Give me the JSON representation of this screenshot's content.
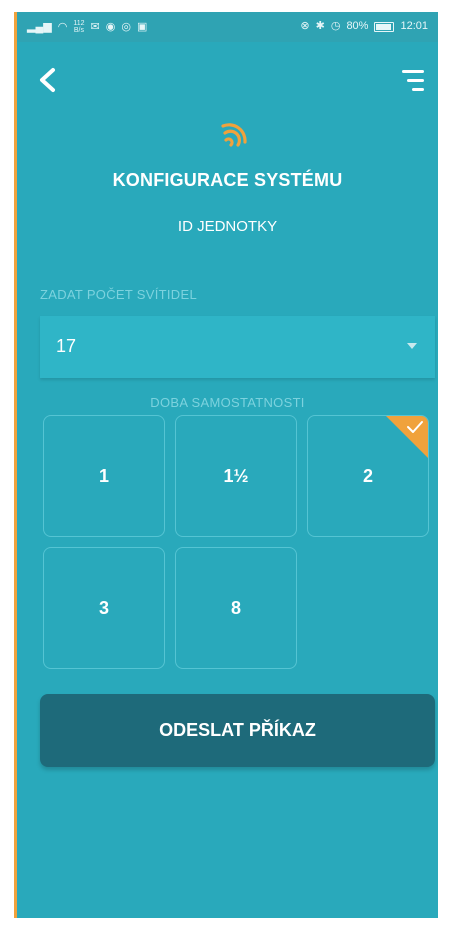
{
  "status_bar": {
    "network_speed_value": "112",
    "network_speed_unit": "B/s",
    "battery": "80%",
    "time": "12:01"
  },
  "header": {
    "back_icon": "back-chevron-icon",
    "menu_icon": "filter-menu-icon"
  },
  "logo": {
    "icon": "wireless-signal-icon",
    "accent_color": "#f0a23c"
  },
  "title": "KONFIGURACE SYSTÉMU",
  "subtitle": "ID JEDNOTKY",
  "lamp_count": {
    "label": "ZADAT POČET SVÍTIDEL",
    "value": "17"
  },
  "autonomy": {
    "label": "DOBA SAMOSTATNOSTI",
    "options": [
      "1",
      "1½",
      "2",
      "3",
      "8"
    ],
    "selected": "2"
  },
  "submit_label": "ODESLAT PŘÍKAZ",
  "colors": {
    "background": "#29a9bb",
    "button": "#1e6a7a",
    "accent": "#f0a23c"
  }
}
